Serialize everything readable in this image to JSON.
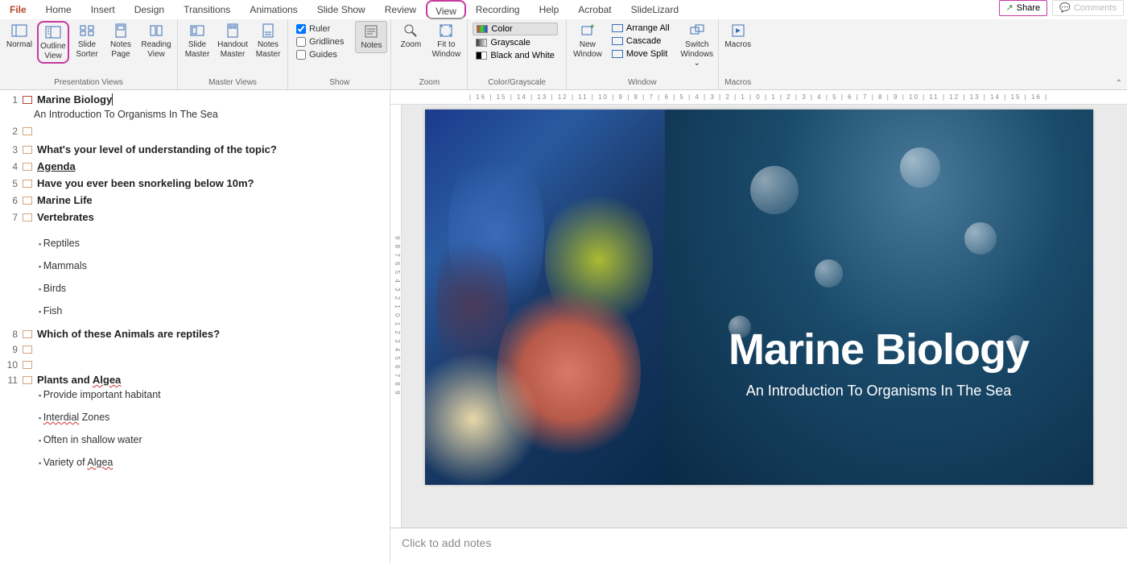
{
  "menu": {
    "tabs": [
      "File",
      "Home",
      "Insert",
      "Design",
      "Transitions",
      "Animations",
      "Slide Show",
      "Review",
      "View",
      "Recording",
      "Help",
      "Acrobat",
      "SlideLizard"
    ],
    "active": "View",
    "share": "Share",
    "comments": "Comments"
  },
  "ribbon": {
    "presentation_views": {
      "normal": "Normal",
      "outline1": "Outline",
      "outline2": "View",
      "sorter1": "Slide",
      "sorter2": "Sorter",
      "notespage1": "Notes",
      "notespage2": "Page",
      "reading1": "Reading",
      "reading2": "View",
      "label": "Presentation Views"
    },
    "master_views": {
      "slide1": "Slide",
      "slide2": "Master",
      "handout1": "Handout",
      "handout2": "Master",
      "notes1": "Notes",
      "notes2": "Master",
      "label": "Master Views"
    },
    "show": {
      "ruler": "Ruler",
      "gridlines": "Gridlines",
      "guides": "Guides",
      "label": "Show"
    },
    "notes": {
      "btn": "Notes"
    },
    "zoom": {
      "zoom": "Zoom",
      "fit1": "Fit to",
      "fit2": "Window",
      "label": "Zoom"
    },
    "colorgray": {
      "color": "Color",
      "gray": "Grayscale",
      "bw": "Black and White",
      "label": "Color/Grayscale"
    },
    "window": {
      "new1": "New",
      "new2": "Window",
      "arrange": "Arrange All",
      "cascade": "Cascade",
      "movesplit": "Move Split",
      "switch1": "Switch",
      "switch2": "Windows",
      "label": "Window"
    },
    "macros": {
      "btn": "Macros",
      "label": "Macros"
    }
  },
  "outline": {
    "s1_title": "Marine Biology",
    "s1_sub": "An Introduction To Organisms In The Sea",
    "s3_title": "What's your level of understanding of the topic?",
    "s4_title": "Agenda",
    "s5_title": "Have you ever been snorkeling below 10m?",
    "s6_title": "Marine Life",
    "s7_title": "Vertebrates",
    "s7_b1": "Reptiles",
    "s7_b2": "Mammals",
    "s7_b3": "Birds",
    "s7_b4": "Fish",
    "s8_title": "Which of these Animals are reptiles?",
    "s11_title_a": "Plants and ",
    "s11_title_b": "Algea",
    "s11_b1": "Provide important habitant",
    "s11_b2a": "Interdial",
    "s11_b2b": " Zones",
    "s11_b3": "Often in shallow water",
    "s11_b4a": "Variety of ",
    "s11_b4b": "Algea "
  },
  "slide": {
    "title": "Marine Biology",
    "sub": "An Introduction To Organisms In The Sea"
  },
  "notes_placeholder": "Click to add notes",
  "hruler": "| 16 | 15 | 14 | 13 | 12 | 11 | 10 | 9 | 8 | 7 | 6 | 5 | 4 | 3 | 2 | 1 | 0 | 1 | 2 | 3 | 4 | 5 | 6 | 7 | 8 | 9 | 10 | 11 | 12 | 13 | 14 | 15 | 16 |",
  "vruler": "9  8  7  6  5  4  3  2  1  0  1  2  3  4  5  6  7  8  9"
}
